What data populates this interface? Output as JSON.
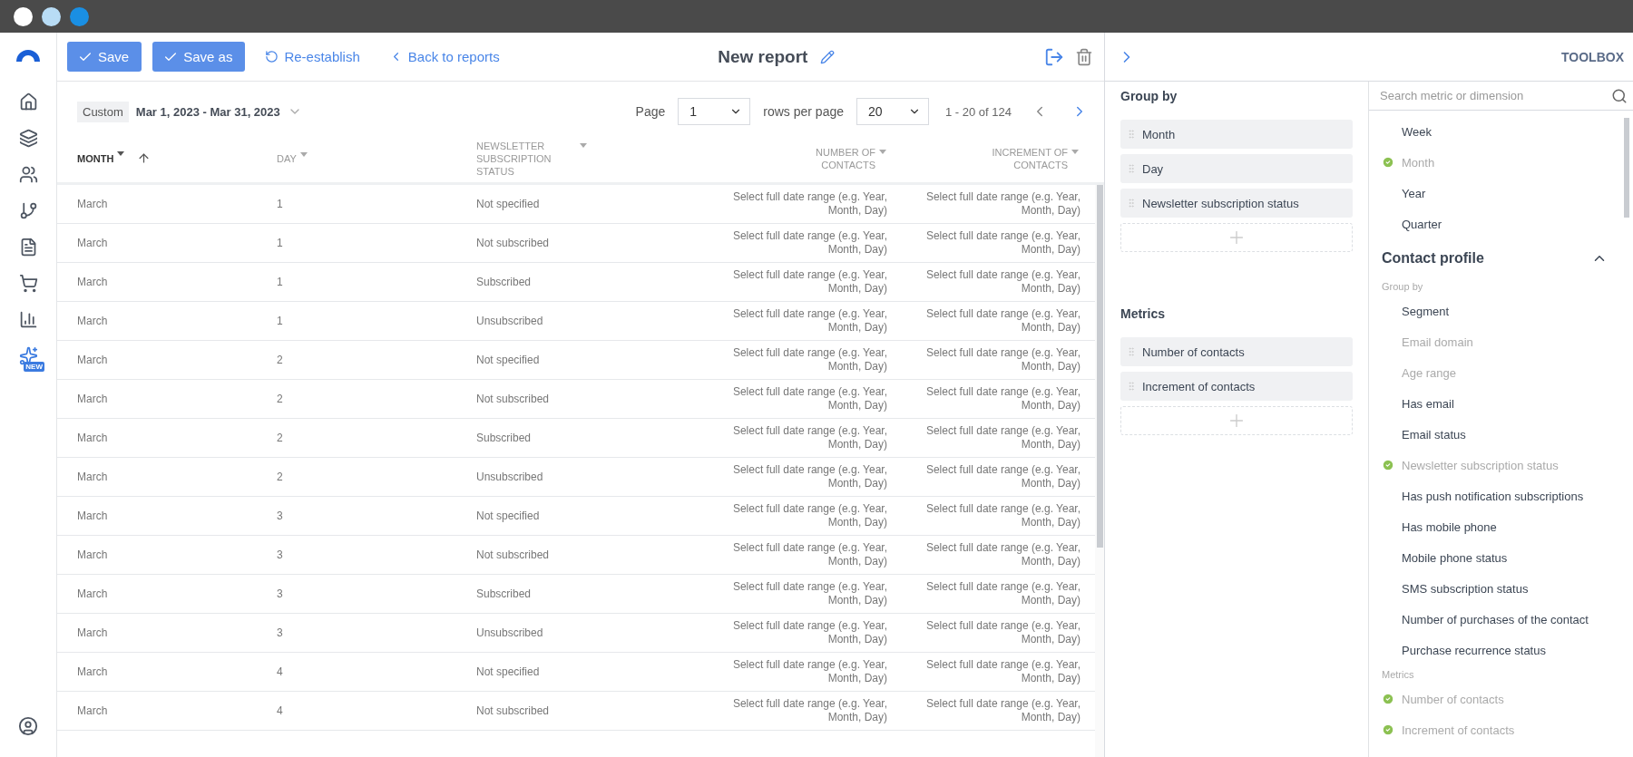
{
  "nav": {
    "badge": "NEW"
  },
  "toolbar": {
    "buttons": [
      {
        "kind": "primary",
        "label": "Save"
      },
      {
        "kind": "primary",
        "label": "Save as"
      },
      {
        "kind": "restore",
        "label": "Re-establish"
      },
      {
        "kind": "back",
        "label": "Back to reports"
      }
    ],
    "title": "New report"
  },
  "filter": {
    "preset": "Custom",
    "range": "Mar 1, 2023 - Mar 31, 2023"
  },
  "pagination": {
    "page_label": "Page",
    "page": "1",
    "rows_label": "rows per page",
    "rows": "20",
    "summary": "1 - 20 of 124"
  },
  "table": {
    "columns": [
      {
        "label": "MONTH",
        "kind": "dimension",
        "sorted": true
      },
      {
        "label": "DAY",
        "kind": "dimension",
        "sorted": false
      },
      {
        "label": "NEWSLETTER SUBSCRIPTION STATUS",
        "kind": "dimension",
        "sorted": false
      },
      {
        "label": "NUMBER OF CONTACTS",
        "kind": "metric",
        "sorted": false
      },
      {
        "label": "INCREMENT OF CONTACTS",
        "kind": "metric",
        "sorted": false
      }
    ],
    "rows": [
      [
        "March",
        "1",
        "Not specified",
        "Select full date range (e.g. Year, Month, Day)",
        "Select full date range (e.g. Year, Month, Day)"
      ],
      [
        "March",
        "1",
        "Not subscribed",
        "Select full date range (e.g. Year, Month, Day)",
        "Select full date range (e.g. Year, Month, Day)"
      ],
      [
        "March",
        "1",
        "Subscribed",
        "Select full date range (e.g. Year, Month, Day)",
        "Select full date range (e.g. Year, Month, Day)"
      ],
      [
        "March",
        "1",
        "Unsubscribed",
        "Select full date range (e.g. Year, Month, Day)",
        "Select full date range (e.g. Year, Month, Day)"
      ],
      [
        "March",
        "2",
        "Not specified",
        "Select full date range (e.g. Year, Month, Day)",
        "Select full date range (e.g. Year, Month, Day)"
      ],
      [
        "March",
        "2",
        "Not subscribed",
        "Select full date range (e.g. Year, Month, Day)",
        "Select full date range (e.g. Year, Month, Day)"
      ],
      [
        "March",
        "2",
        "Subscribed",
        "Select full date range (e.g. Year, Month, Day)",
        "Select full date range (e.g. Year, Month, Day)"
      ],
      [
        "March",
        "2",
        "Unsubscribed",
        "Select full date range (e.g. Year, Month, Day)",
        "Select full date range (e.g. Year, Month, Day)"
      ],
      [
        "March",
        "3",
        "Not specified",
        "Select full date range (e.g. Year, Month, Day)",
        "Select full date range (e.g. Year, Month, Day)"
      ],
      [
        "March",
        "3",
        "Not subscribed",
        "Select full date range (e.g. Year, Month, Day)",
        "Select full date range (e.g. Year, Month, Day)"
      ],
      [
        "March",
        "3",
        "Subscribed",
        "Select full date range (e.g. Year, Month, Day)",
        "Select full date range (e.g. Year, Month, Day)"
      ],
      [
        "March",
        "3",
        "Unsubscribed",
        "Select full date range (e.g. Year, Month, Day)",
        "Select full date range (e.g. Year, Month, Day)"
      ],
      [
        "March",
        "4",
        "Not specified",
        "Select full date range (e.g. Year, Month, Day)",
        "Select full date range (e.g. Year, Month, Day)"
      ],
      [
        "March",
        "4",
        "Not subscribed",
        "Select full date range (e.g. Year, Month, Day)",
        "Select full date range (e.g. Year, Month, Day)"
      ]
    ]
  },
  "panel": {
    "title": "TOOLBOX",
    "sections": [
      {
        "title": "Group by",
        "items": [
          "Month",
          "Day",
          "Newsletter subscription status"
        ]
      },
      {
        "title": "Metrics",
        "items": [
          "Number of contacts",
          "Increment of contacts"
        ]
      }
    ]
  },
  "toolbox": {
    "placeholder": "Search metric or dimension",
    "entries": [
      {
        "kind": "item",
        "label": "Week",
        "added": false
      },
      {
        "kind": "item",
        "label": "Month",
        "added": true
      },
      {
        "kind": "item",
        "label": "Year",
        "added": false
      },
      {
        "kind": "item",
        "label": "Quarter",
        "added": false
      },
      {
        "kind": "section",
        "label": "Contact profile",
        "expanded": true
      },
      {
        "kind": "subhead",
        "label": "Group by"
      },
      {
        "kind": "item",
        "label": "Segment",
        "added": false
      },
      {
        "kind": "item",
        "label": "Email domain",
        "added": false,
        "disabled": true
      },
      {
        "kind": "item",
        "label": "Age range",
        "added": false,
        "disabled": true
      },
      {
        "kind": "item",
        "label": "Has email",
        "added": false
      },
      {
        "kind": "item",
        "label": "Email status",
        "added": false
      },
      {
        "kind": "item",
        "label": "Newsletter subscription status",
        "added": true
      },
      {
        "kind": "item",
        "label": "Has push notification subscriptions",
        "added": false
      },
      {
        "kind": "item",
        "label": "Has mobile phone",
        "added": false
      },
      {
        "kind": "item",
        "label": "Mobile phone status",
        "added": false
      },
      {
        "kind": "item",
        "label": "SMS subscription status",
        "added": false
      },
      {
        "kind": "item",
        "label": "Number of purchases of the contact",
        "added": false
      },
      {
        "kind": "item",
        "label": "Purchase recurrence status",
        "added": false
      },
      {
        "kind": "subhead",
        "label": "Metrics"
      },
      {
        "kind": "item",
        "label": "Number of contacts",
        "added": true
      },
      {
        "kind": "item",
        "label": "Increment of contacts",
        "added": true
      }
    ]
  }
}
